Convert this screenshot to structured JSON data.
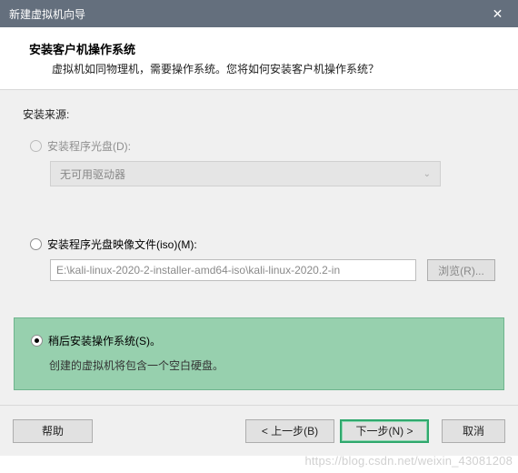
{
  "window": {
    "title": "新建虚拟机向导",
    "close_icon": "✕"
  },
  "header": {
    "title": "安装客户机操作系统",
    "subtitle": "虚拟机如同物理机，需要操作系统。您将如何安装客户机操作系统？"
  },
  "source": {
    "label": "安装来源:"
  },
  "option_disc": {
    "label": "安装程序光盘(D):",
    "drive_text": "无可用驱动器"
  },
  "option_iso": {
    "label": "安装程序光盘映像文件(iso)(M):",
    "path": "E:\\kali-linux-2020-2-installer-amd64-iso\\kali-linux-2020.2-in",
    "browse": "浏览(R)..."
  },
  "option_later": {
    "label": "稍后安装操作系统(S)。",
    "hint": "创建的虚拟机将包含一个空白硬盘。"
  },
  "footer": {
    "help": "帮助",
    "back": "< 上一步(B)",
    "next": "下一步(N) >",
    "cancel": "取消"
  },
  "watermark": "https://blog.csdn.net/weixin_43081208"
}
